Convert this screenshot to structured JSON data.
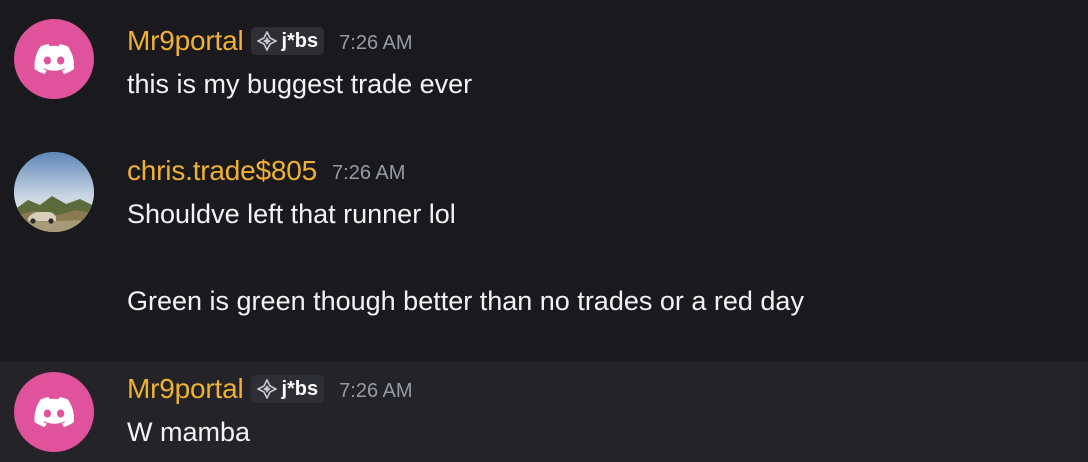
{
  "messages": [
    {
      "username": "Mr9portal",
      "tag": "j*bs",
      "time": "7:26 AM",
      "lines": [
        "this is my buggest trade ever"
      ]
    },
    {
      "username": "chris.trade$805",
      "time": "7:26 AM",
      "lines": [
        "Shouldve left that runner lol",
        "Green is green though better than no trades or a red day"
      ]
    },
    {
      "username": "Mr9portal",
      "tag": "j*bs",
      "time": "7:26 AM",
      "lines": [
        "W mamba"
      ]
    }
  ],
  "colors": {
    "background": "#1a1a1e",
    "username": "#f0b132",
    "timestamp": "#949ba4",
    "discord_avatar": "#e0529c"
  },
  "icons": {
    "default_avatar": "discord-logo-icon",
    "tag_icon": "diamond-sparkle-icon"
  }
}
